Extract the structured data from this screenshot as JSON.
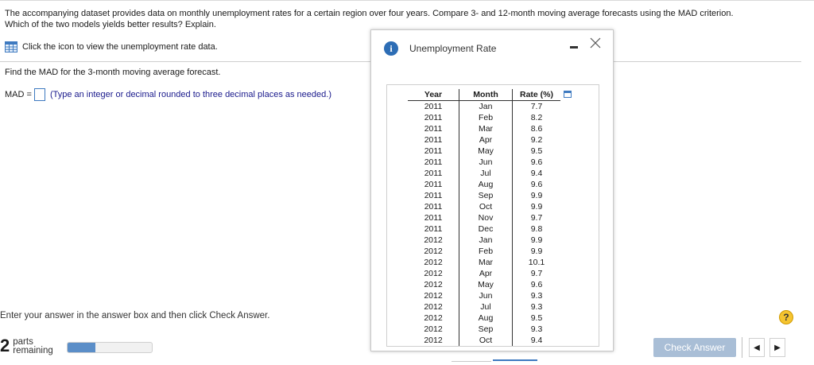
{
  "question": {
    "line1": "The accompanying dataset provides data on monthly unemployment rates for a certain region over four years. Compare 3- and 12-month moving average forecasts using the MAD criterion.",
    "line2": "Which of the two models yields better results? Explain."
  },
  "data_link": {
    "label": "Click the icon to view the unemployment rate data.",
    "icon": "data-table-icon"
  },
  "part": {
    "prompt": "Find the MAD for the 3-month moving average forecast.",
    "mad_label": "MAD =",
    "mad_value": "",
    "hint": "(Type an integer or decimal rounded to three decimal places as needed.)"
  },
  "footer": {
    "instruction": "Enter your answer in the answer box and then click Check Answer.",
    "parts_count": "2",
    "parts_label1": "parts",
    "parts_label2": "remaining",
    "progress_fraction": 0.33,
    "check_button": "Check Answer",
    "help": "?"
  },
  "dialog": {
    "title": "Unemployment Rate",
    "icon": "info-icon",
    "columns": [
      "Year",
      "Month",
      "Rate (%)"
    ],
    "rows": [
      [
        "2011",
        "Jan",
        "7.7"
      ],
      [
        "2011",
        "Feb",
        "8.2"
      ],
      [
        "2011",
        "Mar",
        "8.6"
      ],
      [
        "2011",
        "Apr",
        "9.2"
      ],
      [
        "2011",
        "May",
        "9.5"
      ],
      [
        "2011",
        "Jun",
        "9.6"
      ],
      [
        "2011",
        "Jul",
        "9.4"
      ],
      [
        "2011",
        "Aug",
        "9.6"
      ],
      [
        "2011",
        "Sep",
        "9.9"
      ],
      [
        "2011",
        "Oct",
        "9.9"
      ],
      [
        "2011",
        "Nov",
        "9.7"
      ],
      [
        "2011",
        "Dec",
        "9.8"
      ],
      [
        "2012",
        "Jan",
        "9.9"
      ],
      [
        "2012",
        "Feb",
        "9.9"
      ],
      [
        "2012",
        "Mar",
        "10.1"
      ],
      [
        "2012",
        "Apr",
        "9.7"
      ],
      [
        "2012",
        "May",
        "9.6"
      ],
      [
        "2012",
        "Jun",
        "9.3"
      ],
      [
        "2012",
        "Jul",
        "9.3"
      ],
      [
        "2012",
        "Aug",
        "9.5"
      ],
      [
        "2012",
        "Sep",
        "9.3"
      ],
      [
        "2012",
        "Oct",
        "9.4"
      ]
    ]
  },
  "colors": {
    "accent": "#2d6db5",
    "progress": "#5b8ec8",
    "check_button": "#a9bed6",
    "help": "#f5c430"
  }
}
